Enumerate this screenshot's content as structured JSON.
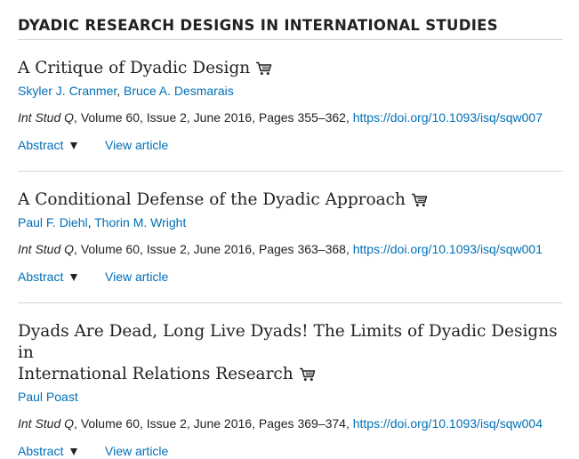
{
  "section": {
    "heading": "DYADIC RESEARCH DESIGNS IN INTERNATIONAL STUDIES"
  },
  "colors": {
    "link": "#006fb7",
    "text": "#222222",
    "divider": "#d4d4d4"
  },
  "icons": {
    "purchase": "shopping-cart-icon",
    "toggle": "triangle-down-icon"
  },
  "articles": [
    {
      "title": "A Critique of Dyadic Design",
      "authors": [
        "Skyler J. Cranmer",
        "Bruce A. Desmarais"
      ],
      "author_separator": ", ",
      "journal": "Int Stud Q",
      "details": ", Volume 60, Issue 2, June 2016, Pages 355–362, ",
      "doi": "https://doi.org/10.1093/isq/sqw007",
      "abstract_label": "Abstract",
      "view_label": "View article"
    },
    {
      "title": "A Conditional Defense of the Dyadic Approach",
      "authors": [
        "Paul F. Diehl",
        "Thorin M. Wright"
      ],
      "author_separator": ", ",
      "journal": "Int Stud Q",
      "details": ", Volume 60, Issue 2, June 2016, Pages 363–368, ",
      "doi": "https://doi.org/10.1093/isq/sqw001",
      "abstract_label": "Abstract",
      "view_label": "View article"
    },
    {
      "title_line1": "Dyads Are Dead, Long Live Dyads! The Limits of Dyadic Designs in",
      "title_line2": "International Relations Research",
      "authors": [
        "Paul Poast"
      ],
      "journal": "Int Stud Q",
      "details": ", Volume 60, Issue 2, June 2016, Pages 369–374, ",
      "doi": "https://doi.org/10.1093/isq/sqw004",
      "abstract_label": "Abstract",
      "view_label": "View article"
    }
  ]
}
